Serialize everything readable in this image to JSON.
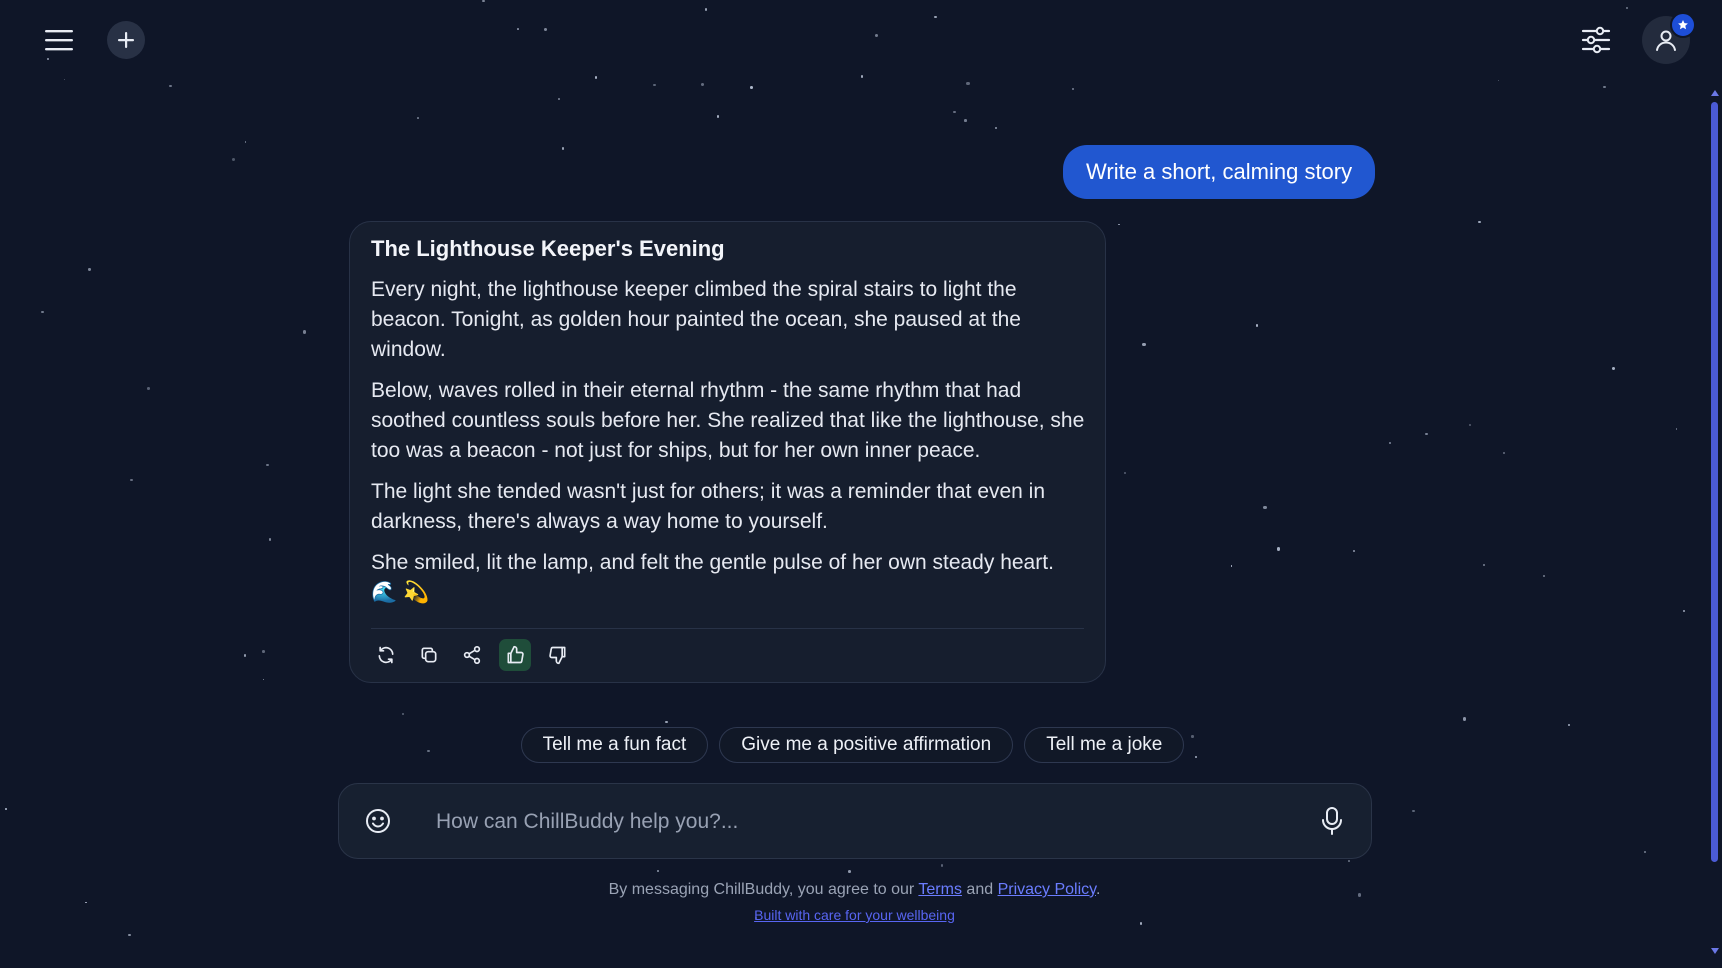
{
  "header": {
    "menu_icon": "hamburger-menu-icon",
    "new_chat_icon": "plus-icon",
    "settings_icon": "sliders-icon",
    "profile_icon": "user-icon",
    "profile_badge_icon": "star-badge-icon"
  },
  "conversation": {
    "user_message": "Write a short, calming story",
    "assistant": {
      "title": "The Lighthouse Keeper's Evening",
      "paragraphs": [
        "Every night, the lighthouse keeper climbed the spiral stairs to light the beacon. Tonight, as golden hour painted the ocean, she paused at the window.",
        "Below, waves rolled in their eternal rhythm - the same rhythm that had soothed countless souls before her. She realized that like the lighthouse, she too was a beacon - not just for ships, but for her own inner peace.",
        "The light she tended wasn't just for others; it was a reminder that even in darkness, there's always a way home to yourself.",
        "She smiled, lit the lamp, and felt the gentle pulse of her own steady heart. 🌊 💫"
      ],
      "actions": [
        {
          "name": "regenerate",
          "icon": "refresh-icon"
        },
        {
          "name": "copy",
          "icon": "copy-icon"
        },
        {
          "name": "share",
          "icon": "share-icon"
        },
        {
          "name": "like",
          "icon": "thumbs-up-icon",
          "active": true
        },
        {
          "name": "dislike",
          "icon": "thumbs-down-icon"
        }
      ]
    }
  },
  "suggestions": [
    "Tell me a fun fact",
    "Give me a positive affirmation",
    "Tell me a joke"
  ],
  "composer": {
    "placeholder": "How can ChillBuddy help you?...",
    "value": "",
    "emoji_icon": "smiley-icon",
    "mic_icon": "microphone-icon"
  },
  "footer": {
    "prefix": "By messaging ChillBuddy, you agree to our ",
    "terms": "Terms",
    "and": " and ",
    "privacy": "Privacy Policy",
    "suffix": ".",
    "subline": "Built with care for your wellbeing"
  },
  "colors": {
    "background": "#0f1628",
    "user_bubble": "#2157d0",
    "card": "#161e2e",
    "link": "#6b7dff",
    "accent_like": "#1f4d3a",
    "scrollbar": "#4b5bd6"
  }
}
